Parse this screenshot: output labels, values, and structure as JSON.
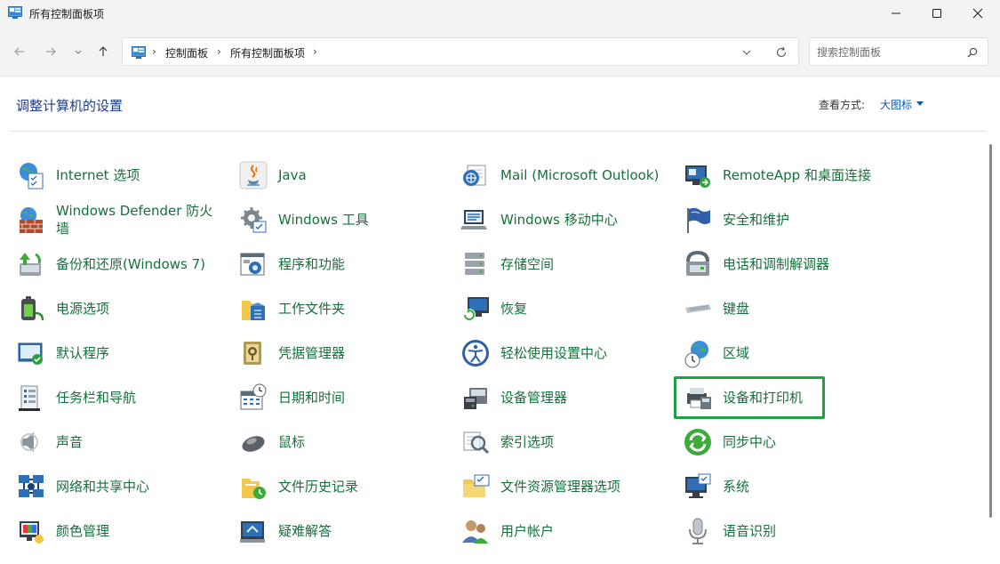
{
  "window": {
    "title": "所有控制面板项"
  },
  "address": {
    "crumbs": [
      "控制面板",
      "所有控制面板项"
    ]
  },
  "search": {
    "placeholder": "搜索控制面板"
  },
  "header": {
    "title": "调整计算机的设置",
    "view_by_label": "查看方式:",
    "view_by_value": "大图标"
  },
  "columns": [
    [
      {
        "label": "Internet 选项",
        "icon": "internet-options-icon"
      },
      {
        "label": "Windows Defender 防火墙",
        "icon": "firewall-icon"
      },
      {
        "label": "备份和还原(Windows 7)",
        "icon": "backup-restore-icon"
      },
      {
        "label": "电源选项",
        "icon": "power-options-icon"
      },
      {
        "label": "默认程序",
        "icon": "default-programs-icon"
      },
      {
        "label": "任务栏和导航",
        "icon": "taskbar-icon"
      },
      {
        "label": "声音",
        "icon": "sound-icon"
      },
      {
        "label": "网络和共享中心",
        "icon": "network-icon"
      },
      {
        "label": "颜色管理",
        "icon": "color-management-icon"
      }
    ],
    [
      {
        "label": "Java",
        "icon": "java-icon"
      },
      {
        "label": "Windows 工具",
        "icon": "windows-tools-icon"
      },
      {
        "label": "程序和功能",
        "icon": "programs-features-icon"
      },
      {
        "label": "工作文件夹",
        "icon": "work-folders-icon"
      },
      {
        "label": "凭据管理器",
        "icon": "credential-manager-icon"
      },
      {
        "label": "日期和时间",
        "icon": "date-time-icon"
      },
      {
        "label": "鼠标",
        "icon": "mouse-icon"
      },
      {
        "label": "文件历史记录",
        "icon": "file-history-icon"
      },
      {
        "label": "疑难解答",
        "icon": "troubleshooting-icon"
      }
    ],
    [
      {
        "label": "Mail (Microsoft Outlook)",
        "icon": "mail-icon"
      },
      {
        "label": "Windows 移动中心",
        "icon": "mobility-center-icon"
      },
      {
        "label": "存储空间",
        "icon": "storage-spaces-icon"
      },
      {
        "label": "恢复",
        "icon": "recovery-icon"
      },
      {
        "label": "轻松使用设置中心",
        "icon": "ease-of-access-icon"
      },
      {
        "label": "设备管理器",
        "icon": "device-manager-icon"
      },
      {
        "label": "索引选项",
        "icon": "indexing-options-icon"
      },
      {
        "label": "文件资源管理器选项",
        "icon": "explorer-options-icon"
      },
      {
        "label": "用户帐户",
        "icon": "user-accounts-icon"
      }
    ],
    [
      {
        "label": "RemoteApp 和桌面连接",
        "icon": "remoteapp-icon"
      },
      {
        "label": "安全和维护",
        "icon": "security-maintenance-icon"
      },
      {
        "label": "电话和调制解调器",
        "icon": "phone-modem-icon"
      },
      {
        "label": "键盘",
        "icon": "keyboard-icon"
      },
      {
        "label": "区域",
        "icon": "region-icon"
      },
      {
        "label": "设备和打印机",
        "icon": "devices-printers-icon"
      },
      {
        "label": "同步中心",
        "icon": "sync-center-icon"
      },
      {
        "label": "系统",
        "icon": "system-icon"
      },
      {
        "label": "语音识别",
        "icon": "speech-recognition-icon"
      }
    ]
  ]
}
